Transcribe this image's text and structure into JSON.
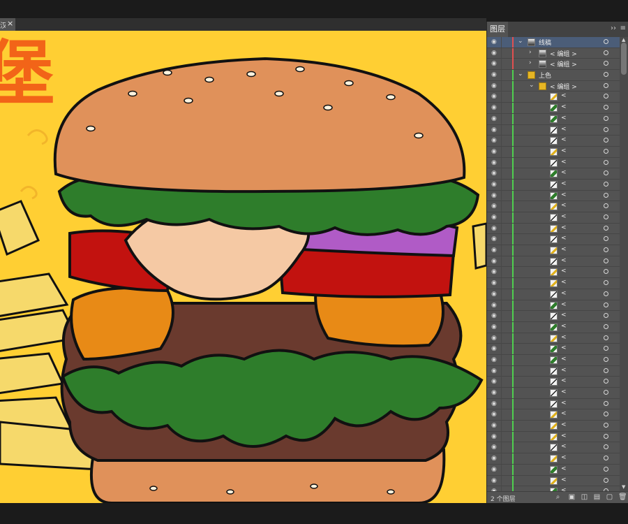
{
  "document": {
    "tab_title": "汉堡",
    "close_glyph": "×"
  },
  "canvas": {
    "headline_glyph": "堡",
    "colors": {
      "background": "#ffcf33",
      "bun": "#e0915a",
      "lettuce": "#2e7d2b",
      "tomato": "#c2120f",
      "onion": "#b05bc6",
      "cheese": "#e88a16",
      "patty": "#6a3a2e",
      "sauce": "#f5c9a4",
      "fries": "#f6d96b",
      "headline": "#f26418",
      "outline": "#111111"
    }
  },
  "layers_panel": {
    "tab_label": "图层",
    "expand_glyph": "››",
    "menu_glyph": "≡",
    "footer_count": "2 个图层",
    "footer_icons": [
      "search-icon",
      "locate-icon",
      "make-clip-icon",
      "new-sublayer-icon",
      "new-layer-icon",
      "delete-icon"
    ],
    "rows": [
      {
        "indent": 0,
        "twirl": "v",
        "thumb": "art",
        "name": "线稿",
        "bar": "red",
        "selected": true
      },
      {
        "indent": 1,
        "twirl": ">",
        "thumb": "art",
        "name": "< 编组 >",
        "bar": "red"
      },
      {
        "indent": 1,
        "twirl": ">",
        "thumb": "art",
        "name": "< 编组 >",
        "bar": "red"
      },
      {
        "indent": 0,
        "twirl": "v",
        "thumb": "folder",
        "name": "上色",
        "bar": "green"
      },
      {
        "indent": 1,
        "twirl": "v",
        "thumb": "folder",
        "name": "< 编组 >",
        "bar": "green"
      },
      {
        "indent": 2,
        "thumb": "shape",
        "glyph": "yellow",
        "name": "<",
        "bar": "green"
      },
      {
        "indent": 2,
        "thumb": "shape",
        "glyph": "green",
        "name": "<",
        "bar": "green"
      },
      {
        "indent": 2,
        "thumb": "shape",
        "glyph": "green",
        "name": "<",
        "bar": "green"
      },
      {
        "indent": 2,
        "thumb": "shape",
        "glyph": "line",
        "name": "<",
        "bar": "green"
      },
      {
        "indent": 2,
        "thumb": "shape",
        "glyph": "line",
        "name": "<",
        "bar": "green"
      },
      {
        "indent": 2,
        "thumb": "shape",
        "glyph": "yellow",
        "name": "<",
        "bar": "green"
      },
      {
        "indent": 2,
        "thumb": "shape",
        "glyph": "line",
        "name": "<",
        "bar": "green"
      },
      {
        "indent": 2,
        "thumb": "shape",
        "glyph": "green",
        "name": "<",
        "bar": "green"
      },
      {
        "indent": 2,
        "thumb": "shape",
        "glyph": "line",
        "name": "<",
        "bar": "green"
      },
      {
        "indent": 2,
        "thumb": "shape",
        "glyph": "green",
        "name": "<",
        "bar": "green"
      },
      {
        "indent": 2,
        "thumb": "shape",
        "glyph": "yellow",
        "name": "<",
        "bar": "green"
      },
      {
        "indent": 2,
        "thumb": "shape",
        "glyph": "line",
        "name": "<",
        "bar": "green"
      },
      {
        "indent": 2,
        "thumb": "shape",
        "glyph": "yellow",
        "name": "<",
        "bar": "green"
      },
      {
        "indent": 2,
        "thumb": "shape",
        "glyph": "line",
        "name": "<",
        "bar": "green"
      },
      {
        "indent": 2,
        "thumb": "shape",
        "glyph": "yellow",
        "name": "<",
        "bar": "green"
      },
      {
        "indent": 2,
        "thumb": "shape",
        "glyph": "line",
        "name": "<",
        "bar": "green"
      },
      {
        "indent": 2,
        "thumb": "shape",
        "glyph": "yellow",
        "name": "<",
        "bar": "green"
      },
      {
        "indent": 2,
        "thumb": "shape",
        "glyph": "yellow",
        "name": "<",
        "bar": "green"
      },
      {
        "indent": 2,
        "thumb": "shape",
        "glyph": "line",
        "name": "<",
        "bar": "green"
      },
      {
        "indent": 2,
        "thumb": "shape",
        "glyph": "green",
        "name": "<",
        "bar": "green"
      },
      {
        "indent": 2,
        "thumb": "shape",
        "glyph": "line",
        "name": "<",
        "bar": "green"
      },
      {
        "indent": 2,
        "thumb": "shape",
        "glyph": "green",
        "name": "<",
        "bar": "green"
      },
      {
        "indent": 2,
        "thumb": "shape",
        "glyph": "yellow",
        "name": "<",
        "bar": "green"
      },
      {
        "indent": 2,
        "thumb": "shape",
        "glyph": "green",
        "name": "<",
        "bar": "green"
      },
      {
        "indent": 2,
        "thumb": "shape",
        "glyph": "green",
        "name": "<",
        "bar": "green"
      },
      {
        "indent": 2,
        "thumb": "shape",
        "glyph": "line",
        "name": "<",
        "bar": "green"
      },
      {
        "indent": 2,
        "thumb": "shape",
        "glyph": "line",
        "name": "<",
        "bar": "green"
      },
      {
        "indent": 2,
        "thumb": "shape",
        "glyph": "line",
        "name": "<",
        "bar": "green"
      },
      {
        "indent": 2,
        "thumb": "shape",
        "glyph": "line",
        "name": "<",
        "bar": "green"
      },
      {
        "indent": 2,
        "thumb": "shape",
        "glyph": "yellow",
        "name": "<",
        "bar": "green"
      },
      {
        "indent": 2,
        "thumb": "shape",
        "glyph": "yellow",
        "name": "<",
        "bar": "green"
      },
      {
        "indent": 2,
        "thumb": "shape",
        "glyph": "yellow",
        "name": "<",
        "bar": "green"
      },
      {
        "indent": 2,
        "thumb": "shape",
        "glyph": "line",
        "name": "<",
        "bar": "green"
      },
      {
        "indent": 2,
        "thumb": "shape",
        "glyph": "yellow",
        "name": "<",
        "bar": "green"
      },
      {
        "indent": 2,
        "thumb": "shape",
        "glyph": "green",
        "name": "<",
        "bar": "green"
      },
      {
        "indent": 2,
        "thumb": "shape",
        "glyph": "yellow",
        "name": "<",
        "bar": "green"
      },
      {
        "indent": 2,
        "thumb": "shape",
        "glyph": "green",
        "name": "<",
        "bar": "green"
      }
    ]
  }
}
